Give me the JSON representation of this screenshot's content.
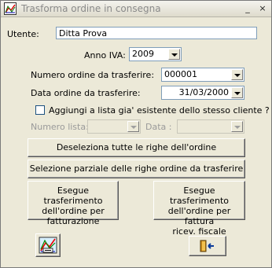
{
  "window": {
    "title": "Trasforma ordine in consegna",
    "controls": {
      "minimize": "_",
      "close": "×"
    }
  },
  "form": {
    "utente_label": "Utente:",
    "utente_value": "Ditta Prova",
    "anno_label": "Anno IVA:",
    "anno_value": "2009",
    "numero_label": "Numero ordine da trasferire:",
    "numero_value": "000001",
    "data_label": "Data ordine da trasferire:",
    "data_value": "31/03/2000",
    "aggiungi_label": "Aggiungi a lista gia' esistente dello stesso cliente ?",
    "aggiungi_checked": false,
    "numero_lista_label": "Numero lista:",
    "numero_lista_value": "",
    "data_lista_label": "Data :",
    "data_lista_value": ""
  },
  "buttons": {
    "deseleziona": "Deseleziona tutte le righe dell'ordine",
    "selezione_parziale": "Selezione parziale delle righe ordine da trasferire",
    "fatturazione": [
      "Esegue trasferimento",
      "dell'ordine per",
      "fatturazione"
    ],
    "fattura_ricev": [
      "Esegue trasferimento",
      "dell'ordine per fattura",
      "ricev. fiscale"
    ]
  },
  "icons": {
    "title": "app-chart-icon",
    "left": "calculator-chart-icon",
    "right": "exit-door-icon"
  }
}
